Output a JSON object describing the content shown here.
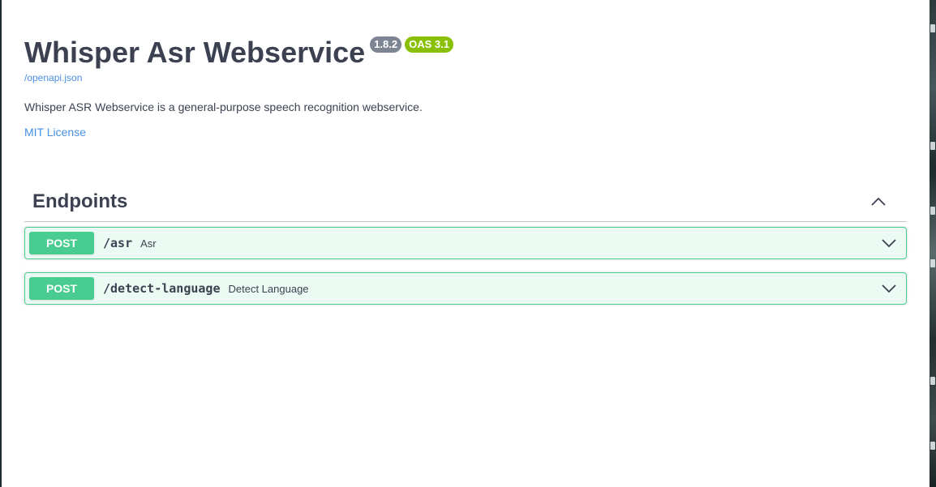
{
  "info": {
    "title": "Whisper Asr Webservice",
    "version_badge": "1.8.2",
    "oas_badge": "OAS 3.1",
    "spec_link": "/openapi.json",
    "description": "Whisper ASR Webservice is a general-purpose speech recognition webservice.",
    "license": "MIT License"
  },
  "section": {
    "title": "Endpoints",
    "toggle_icon": "chevron-up-icon"
  },
  "operations": [
    {
      "method": "POST",
      "path": "/asr",
      "summary": "Asr",
      "expand_icon": "chevron-down-icon"
    },
    {
      "method": "POST",
      "path": "/detect-language",
      "summary": "Detect Language",
      "expand_icon": "chevron-down-icon"
    }
  ],
  "colors": {
    "post_accent": "#49cc90",
    "link": "#4990e2",
    "text": "#3b4151",
    "version_badge": "#7d8492",
    "oas_badge": "#89bf04"
  }
}
